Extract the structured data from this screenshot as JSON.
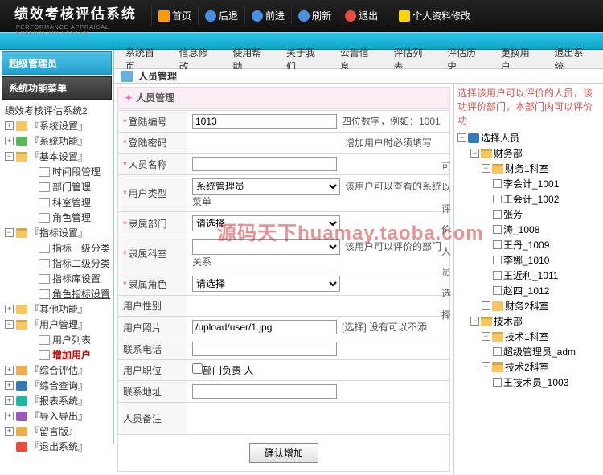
{
  "header": {
    "title": "绩效考核评估系统",
    "subtitle": "PERFORMANCE APPRAISAL EVALUATION SYSTEM",
    "buttons": {
      "home": "首页",
      "back": "后退",
      "forward": "前进",
      "refresh": "刷新",
      "exit": "退出",
      "profile": "个人资料修改"
    }
  },
  "leftpanel": {
    "tab1": "超级管理员",
    "tab2": "系统功能菜单",
    "root": "绩效考核评估系统2",
    "nodes": {
      "n1": "『系统设置』",
      "n2": "『系统功能』",
      "n3": "『基本设置』",
      "n3_1": "时间段管理",
      "n3_2": "部门管理",
      "n3_3": "科室管理",
      "n3_4": "角色管理",
      "n4": "『指标设置』",
      "n4_1": "指标一级分类",
      "n4_2": "指标二级分类",
      "n4_3": "指标库设置",
      "n4_4": "角色指标设置",
      "n5": "『其他功能』",
      "n6": "『用户管理』",
      "n6_1": "用户列表",
      "n6_2": "增加用户",
      "n7": "『综合评估』",
      "n8": "『综合查询』",
      "n9": "『报表系统』",
      "n10": "『导入导出』",
      "n11": "『留言版』",
      "n12": "『退出系统』"
    }
  },
  "menubar": {
    "m1": "系统首页",
    "m2": "信息修改",
    "m3": "使用帮助",
    "m4": "关于我们",
    "m5": "公告信息",
    "m6": "评估列表",
    "m7": "评估历史",
    "m8": "更换用户",
    "m9": "退出系统"
  },
  "crumb": "人员管理",
  "subtitle": "人员管理",
  "form": {
    "f1": {
      "label": "登陆编号",
      "value": "1013",
      "hint": "四位数字，例如：1001"
    },
    "f2": {
      "label": "登陆密码",
      "hint": "增加用户时必须填写"
    },
    "f3": {
      "label": "人员名称"
    },
    "f4": {
      "label": "用户类型",
      "value": "系统管理员",
      "hint": "该用户可以查看的系统菜单"
    },
    "f5": {
      "label": "隶属部门",
      "value": "请选择"
    },
    "f6": {
      "label": "隶属科室",
      "hint": "该用户可以评价的部门关系"
    },
    "f7": {
      "label": "隶属角色",
      "value": "请选择"
    },
    "f8": {
      "label": "用户性别"
    },
    "f9": {
      "label": "用户照片",
      "value": "/upload/user/1.jpg",
      "hint": "[选择] 没有可以不添"
    },
    "f10": {
      "label": "联系电话"
    },
    "f11": {
      "label": "用户职位",
      "cb": "部门负责 人"
    },
    "f12": {
      "label": "联系地址"
    },
    "f13": {
      "label": "人员备注"
    },
    "submit": "确认增加"
  },
  "rightpanel": {
    "tip": "选择该用户可以评价的人员，该功评价部门，本部门内可以评价功",
    "root": "选择人员",
    "dept1": "财务部",
    "room1": "财务1科室",
    "p1": "李会计_1001",
    "p2": "王会计_1002",
    "p3": "张芳",
    "p4": "涛_1008",
    "p5": "王丹_1009",
    "p6": "李娜_1010",
    "p7": "王近利_1011",
    "p8": "赵四_1012",
    "room2": "财务2科室",
    "dept2": "技术部",
    "room3": "技术1科室",
    "p9": "超级管理员_adm",
    "room4": "技术2科室",
    "p10": "王技术员_1003",
    "vtext": "可以评价人员选择"
  },
  "watermark": "源码天下huamay.taoba.com"
}
